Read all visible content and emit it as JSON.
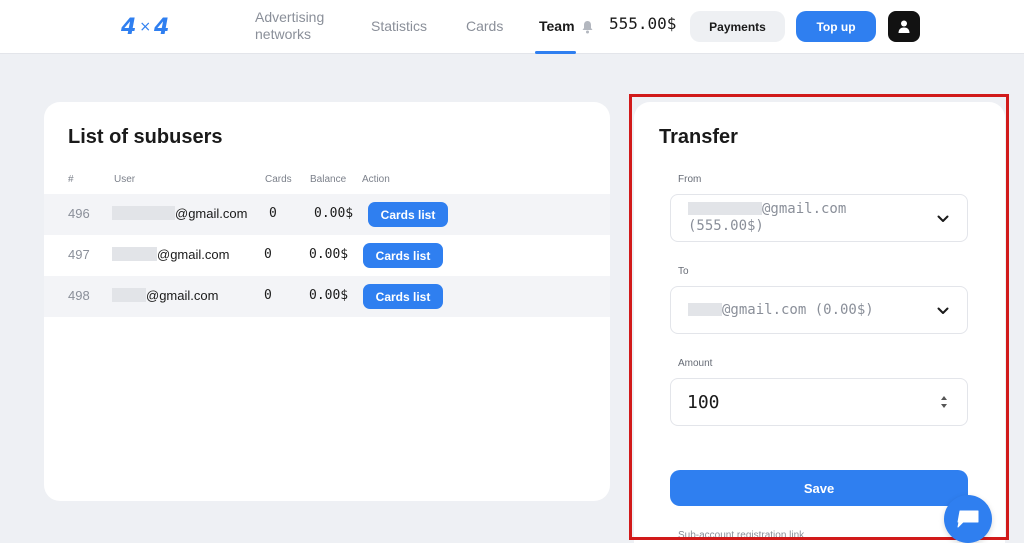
{
  "header": {
    "logo": {
      "left": "4",
      "sep": "×",
      "right": "4"
    },
    "nav": {
      "advertising": "Advertising networks",
      "statistics": "Statistics",
      "cards": "Cards",
      "team": "Team"
    },
    "balance": "555.00$",
    "payments_label": "Payments",
    "topup_label": "Top up"
  },
  "subusers": {
    "title": "List of subusers",
    "columns": {
      "num": "#",
      "user": "User",
      "cards": "Cards",
      "balance": "Balance",
      "action": "Action"
    },
    "rows": [
      {
        "num": "496",
        "email_suffix": "@gmail.com",
        "cards": "0",
        "balance": "0.00$",
        "action": "Cards list"
      },
      {
        "num": "497",
        "email_suffix": "@gmail.com",
        "cards": "0",
        "balance": "0.00$",
        "action": "Cards list"
      },
      {
        "num": "498",
        "email_suffix": "@gmail.com",
        "cards": "0",
        "balance": "0.00$",
        "action": "Cards list"
      }
    ]
  },
  "transfer": {
    "title": "Transfer",
    "from_label": "From",
    "from_value_line1": "@gmail.com",
    "from_value_line2": "(555.00$)",
    "to_label": "To",
    "to_value": "@gmail.com (0.00$)",
    "amount_label": "Amount",
    "amount_value": "100",
    "save_label": "Save",
    "registration_link_label": "Sub-account registration link"
  },
  "colors": {
    "accent": "#2f7ff0",
    "highlight": "#d11a1a",
    "background": "#eef0f4"
  },
  "icons": [
    "bell-icon",
    "user-icon",
    "chevron-down-icon",
    "stepper-icon",
    "chat-icon"
  ]
}
